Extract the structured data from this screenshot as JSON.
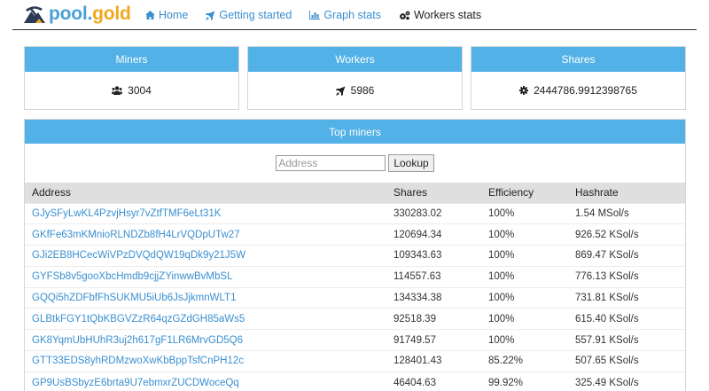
{
  "brand": {
    "name_prefix": "pool",
    "name_dot": ".",
    "name_suffix": "gold"
  },
  "nav": [
    {
      "label": "Home",
      "icon": "home-icon"
    },
    {
      "label": "Getting started",
      "icon": "rocket-icon"
    },
    {
      "label": "Graph stats",
      "icon": "bar-chart-icon"
    },
    {
      "label": "Workers stats",
      "icon": "gears-icon",
      "active": true
    }
  ],
  "stats": {
    "miners": {
      "title": "Miners",
      "value": "3004",
      "icon": "users-icon"
    },
    "workers": {
      "title": "Workers",
      "value": "5986",
      "icon": "rocket-icon"
    },
    "shares": {
      "title": "Shares",
      "value": "2444786.9912398765",
      "icon": "gear-icon"
    }
  },
  "top_miners": {
    "title": "Top miners",
    "search_placeholder": "Address",
    "lookup_label": "Lookup",
    "columns": [
      "Address",
      "Shares",
      "Efficiency",
      "Hashrate"
    ],
    "rows": [
      [
        "GJySFyLwKL4PzvjHsyr7vZtfTMF6eLt31K",
        "330283.02",
        "100%",
        "1.54 MSol/s"
      ],
      [
        "GKfFe63mKMnioRLNDZb8fH4LrVQDpUTw27",
        "120694.34",
        "100%",
        "926.52 KSol/s"
      ],
      [
        "GJi2EB8HCecWiVPzDVQdQW19qDk9y21J5W",
        "109343.63",
        "100%",
        "869.47 KSol/s"
      ],
      [
        "GYFSb8v5gooXbcHmdb9cjjZYinwwBvMbSL",
        "114557.63",
        "100%",
        "776.13 KSol/s"
      ],
      [
        "GQQi5hZDFbfFhSUKMU5iUb6JsJjkmnWLT1",
        "134334.38",
        "100%",
        "731.81 KSol/s"
      ],
      [
        "GLBtkFGY1tQbKBGVZzR64qzGZdGH85aWs5",
        "92518.39",
        "100%",
        "615.40 KSol/s"
      ],
      [
        "GK8YqmUbHUhR3uj2h617gF1LR6MrvGD5Q6",
        "91749.57",
        "100%",
        "557.91 KSol/s"
      ],
      [
        "GTT33EDS8yhRDMzwoXwKbBppTsfCnPH12c",
        "128401.43",
        "85.22%",
        "507.65 KSol/s"
      ],
      [
        "GP9UsBSbyzE6brta9U7ebmxrZUCDWoceQq",
        "46404.63",
        "99.92%",
        "325.49 KSol/s"
      ]
    ]
  }
}
